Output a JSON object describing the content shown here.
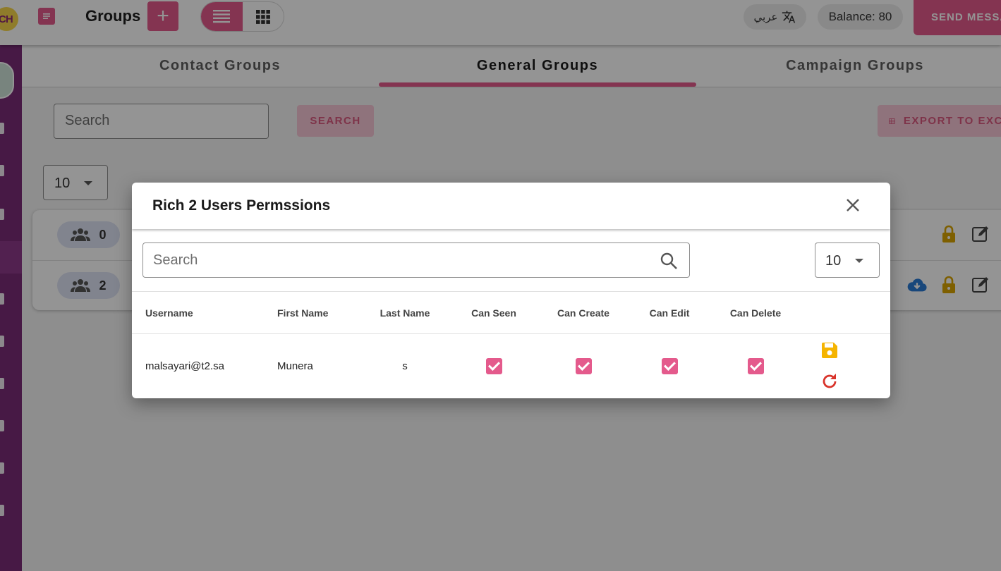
{
  "topbar": {
    "logo_text": "CH",
    "title": "Groups",
    "add_label": "+",
    "language_label": "عربي",
    "balance_label": "Balance: 80",
    "send_label": "SEND MESSAGE"
  },
  "tabs": [
    {
      "label": "Contact Groups"
    },
    {
      "label": "General Groups",
      "active": true
    },
    {
      "label": "Campaign Groups"
    }
  ],
  "toolbar": {
    "search_placeholder": "Search",
    "search_button": "SEARCH",
    "export_button": "EXPORT TO EXCEL",
    "page_size": "10"
  },
  "groups": [
    {
      "count": "0"
    },
    {
      "count": "2"
    }
  ],
  "modal": {
    "title": "Rich 2 Users Permssions",
    "search_placeholder": "Search",
    "page_size": "10",
    "columns": [
      "Username",
      "First Name",
      "Last Name",
      "Can Seen",
      "Can Create",
      "Can Edit",
      "Can Delete"
    ],
    "rows": [
      {
        "username": "malsayari@t2.sa",
        "first_name": "Munera",
        "last_name": "s",
        "can_seen": true,
        "can_create": true,
        "can_edit": true,
        "can_delete": true
      }
    ]
  },
  "colors": {
    "accent": "#e45a8c",
    "sidebar": "#7a2c78",
    "save_icon": "#f5b400",
    "reset_icon": "#d9342b",
    "lock_icon": "#d9a400",
    "download_icon": "#2a7ad5"
  }
}
